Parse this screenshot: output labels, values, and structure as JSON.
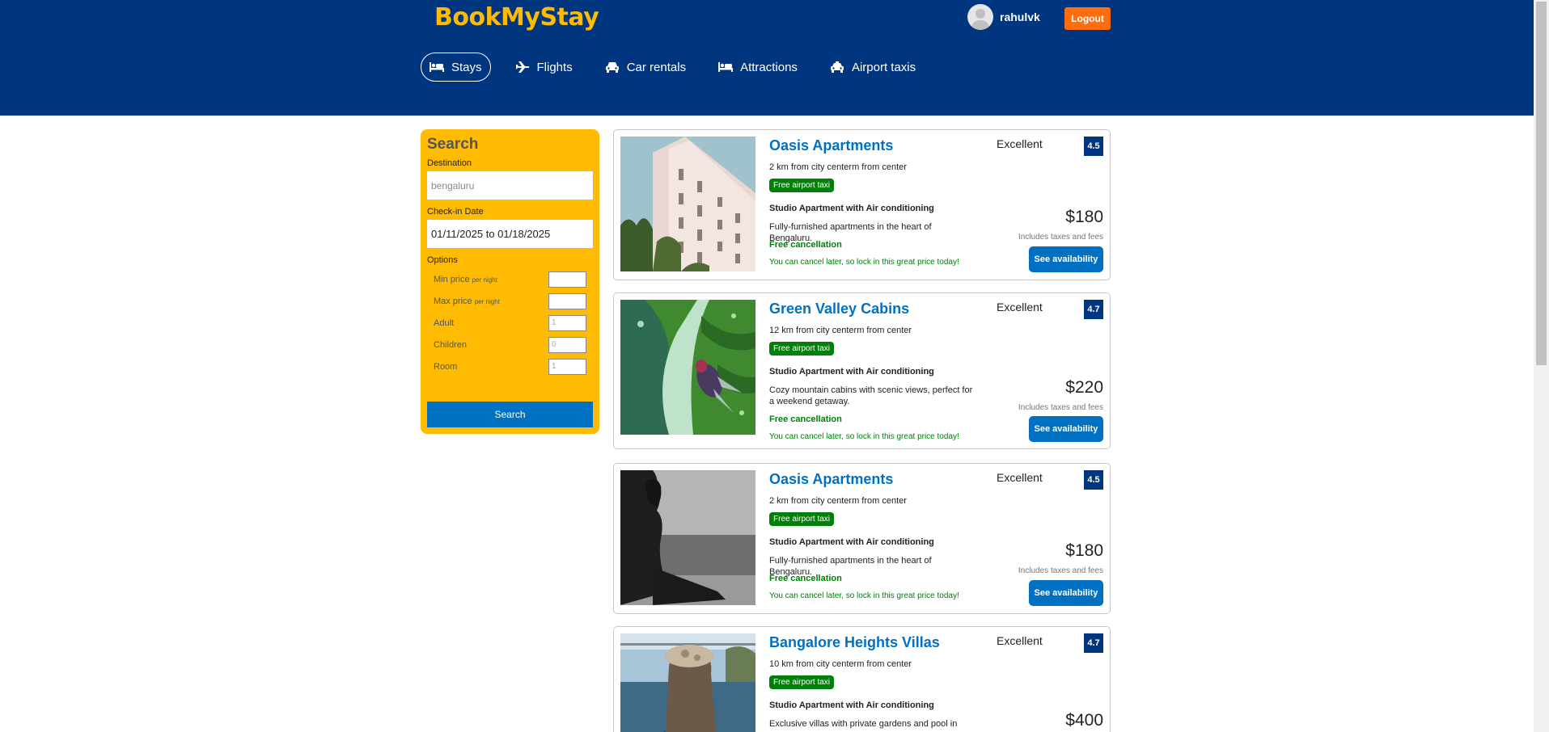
{
  "header": {
    "logo": "BookMyStay",
    "username": "rahulvk",
    "logout_label": "Logout",
    "nav": [
      {
        "label": "Stays",
        "icon": "bed-icon",
        "active": true
      },
      {
        "label": "Flights",
        "icon": "plane-icon",
        "active": false
      },
      {
        "label": "Car rentals",
        "icon": "car-icon",
        "active": false
      },
      {
        "label": "Attractions",
        "icon": "bed-icon",
        "active": false
      },
      {
        "label": "Airport taxis",
        "icon": "taxi-icon",
        "active": false
      }
    ]
  },
  "search": {
    "title": "Search",
    "destination_label": "Destination",
    "destination_value": "bengaluru",
    "checkin_label": "Check-in Date",
    "checkin_value": "01/11/2025 to 01/18/2025",
    "options_label": "Options",
    "options": [
      {
        "label": "Min price",
        "suffix": "per night",
        "value": ""
      },
      {
        "label": "Max price",
        "suffix": "per night",
        "value": ""
      },
      {
        "label": "Adult",
        "suffix": "",
        "value": "1"
      },
      {
        "label": "Children",
        "suffix": "",
        "value": "0"
      },
      {
        "label": "Room",
        "suffix": "",
        "value": "1"
      }
    ],
    "button_label": "Search"
  },
  "results": [
    {
      "name": "Oasis Apartments",
      "distance": "2 km from city centerm from center",
      "taxi_badge": "Free airport taxi",
      "subtitle": "Studio Apartment with Air conditioning",
      "description": "Fully-furnished apartments in the heart of Bengaluru.",
      "cancel": "Free cancellation",
      "cancel_sub": "You can cancel later, so lock in this great price today!",
      "rating_text": "Excellent",
      "rating": "4.5",
      "price": "$180",
      "tax_note": "Includes taxes and fees",
      "avail_label": "See availability"
    },
    {
      "name": "Green Valley Cabins",
      "distance": "12 km from city centerm from center",
      "taxi_badge": "Free airport taxi",
      "subtitle": "Studio Apartment with Air conditioning",
      "description": "Cozy mountain cabins with scenic views, perfect for a weekend getaway.",
      "cancel": "Free cancellation",
      "cancel_sub": "You can cancel later, so lock in this great price today!",
      "rating_text": "Excellent",
      "rating": "4.7",
      "price": "$220",
      "tax_note": "Includes taxes and fees",
      "avail_label": "See availability"
    },
    {
      "name": "Oasis Apartments",
      "distance": "2 km from city centerm from center",
      "taxi_badge": "Free airport taxi",
      "subtitle": "Studio Apartment with Air conditioning",
      "description": "Fully-furnished apartments in the heart of Bengaluru.",
      "cancel": "Free cancellation",
      "cancel_sub": "You can cancel later, so lock in this great price today!",
      "rating_text": "Excellent",
      "rating": "4.5",
      "price": "$180",
      "tax_note": "Includes taxes and fees",
      "avail_label": "See availability"
    },
    {
      "name": "Bangalore Heights Villas",
      "distance": "10 km from city centerm from center",
      "taxi_badge": "Free airport taxi",
      "subtitle": "Studio Apartment with Air conditioning",
      "description": "Exclusive villas with private gardens and pool in",
      "rating_text": "Excellent",
      "rating": "4.7",
      "price": "$400"
    }
  ]
}
